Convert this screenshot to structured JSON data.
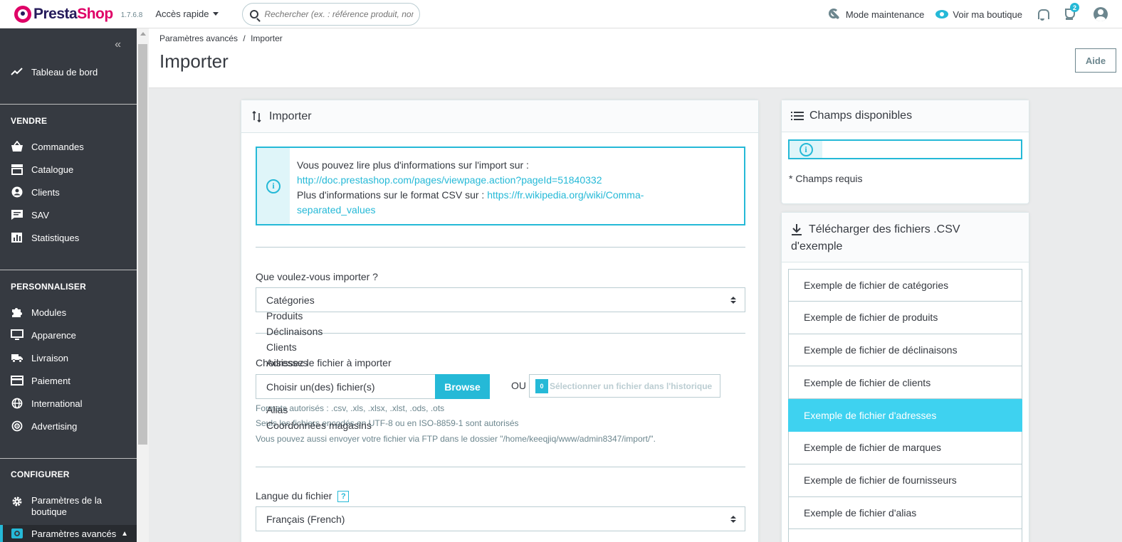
{
  "header": {
    "logo_left": "Presta",
    "logo_right": "Shop",
    "version": "1.7.6.8",
    "quick_access": "Accès rapide",
    "search_placeholder": "Rechercher (ex. : référence produit, nom",
    "maintenance": "Mode maintenance",
    "view_shop": "Voir ma boutique",
    "notif_count": "2"
  },
  "sidebar": {
    "collapse": "«",
    "dashboard": "Tableau de bord",
    "sections": [
      {
        "title": "VENDRE",
        "items": [
          "Commandes",
          "Catalogue",
          "Clients",
          "SAV",
          "Statistiques"
        ]
      },
      {
        "title": "PERSONNALISER",
        "items": [
          "Modules",
          "Apparence",
          "Livraison",
          "Paiement",
          "International",
          "Advertising"
        ]
      },
      {
        "title": "CONFIGURER",
        "items": [
          "Paramètres de la boutique",
          "Paramètres avancés"
        ]
      }
    ]
  },
  "page": {
    "breadcrumb_parent": "Paramètres avancés",
    "breadcrumb_sep": "/",
    "breadcrumb_current": "Importer",
    "title": "Importer",
    "help_button": "Aide"
  },
  "import_card": {
    "title": "Importer",
    "info_line1": "Vous pouvez lire plus d'informations sur l'import sur :",
    "info_link1": "http://doc.prestashop.com/pages/viewpage.action?pageId=51840332",
    "info_line2": "Plus d'informations sur le format CSV sur :",
    "info_link2a": "https://fr.wikipedia.org/wiki/Comma-",
    "info_link2b": "separated_values",
    "what_label": "Que voulez-vous importer ?",
    "what_selected": "Catégories",
    "what_options": [
      "Produits",
      "Déclinaisons",
      "Clients",
      "Adresses",
      "Alias",
      "Coordonnées magasins"
    ],
    "file_label": "Choisissez le fichier à importer",
    "file_input": "Choisir un(des) fichier(s)",
    "browse": "Browse",
    "or": "OU",
    "history_count": "0",
    "history_button": "Sélectionner un fichier dans l'historique",
    "help1": "Formats autorisés : .csv, .xls, .xlsx, .xlst, .ods, .ots",
    "help2": "Seuls les fichiers encodés en UTF-8 ou en ISO-8859-1 sont autorisés",
    "help3": "Vous pouvez aussi envoyer votre fichier via FTP dans le dossier \"/home/keeqjiq/www/admin8347/import/\".",
    "lang_label": "Langue du fichier",
    "lang_help": "?",
    "lang_selected": "Français (French)"
  },
  "fields_card": {
    "title": "Champs disponibles",
    "required_note": "* Champs requis"
  },
  "csv_card": {
    "title_line1": "Télécharger des fichiers .CSV",
    "title_line2": "d'exemple",
    "items": [
      "Exemple de fichier de catégories",
      "Exemple de fichier de produits",
      "Exemple de fichier de déclinaisons",
      "Exemple de fichier de clients",
      "Exemple de fichier d'adresses",
      "Exemple de fichier de marques",
      "Exemple de fichier de fournisseurs",
      "Exemple de fichier d'alias"
    ],
    "active_index": 4
  },
  "colors": {
    "primary": "#25b9d7",
    "sidebar": "#363a41",
    "active_list": "#3ed2f0",
    "brand_pink": "#df0067"
  }
}
